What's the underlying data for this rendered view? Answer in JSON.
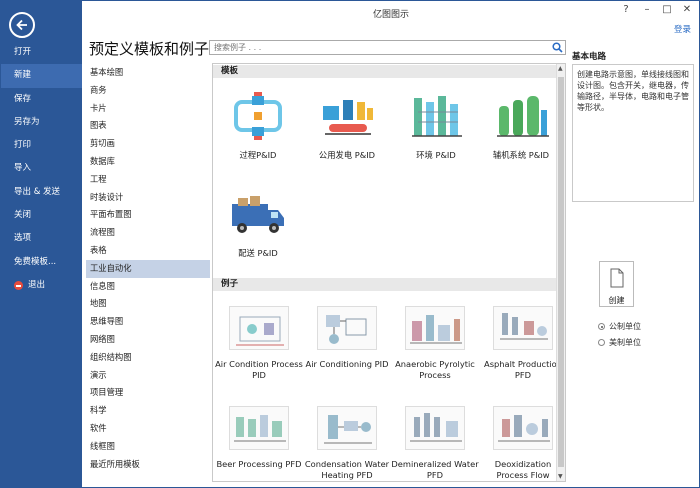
{
  "app": {
    "title": "亿图图示",
    "login": "登录"
  },
  "sidebar": {
    "items": [
      {
        "label": "打开"
      },
      {
        "label": "新建"
      },
      {
        "label": "保存"
      },
      {
        "label": "另存为"
      },
      {
        "label": "打印"
      },
      {
        "label": "导入"
      },
      {
        "label": "导出 & 发送"
      },
      {
        "label": "关闭"
      },
      {
        "label": "选项"
      },
      {
        "label": "免费模板..."
      },
      {
        "label": "退出"
      }
    ],
    "active": "新建"
  },
  "main": {
    "heading": "预定义模板和例子",
    "search_placeholder": "搜索例子 . . .",
    "categories": [
      "基本绘图",
      "商务",
      "卡片",
      "图表",
      "剪切画",
      "数据库",
      "工程",
      "时装设计",
      "平面布置图",
      "流程图",
      "表格",
      "工业自动化",
      "信息图",
      "地图",
      "思维导图",
      "网络图",
      "组织结构图",
      "演示",
      "项目管理",
      "科学",
      "软件",
      "线框图",
      "最近所用模板"
    ],
    "selected_category": "工业自动化",
    "templates_header": "模板",
    "templates": [
      {
        "label": "过程P&ID",
        "icon": "process-pid-icon"
      },
      {
        "label": "公用发电 P&ID",
        "icon": "utility-power-pid-icon"
      },
      {
        "label": "环境 P&ID",
        "icon": "environment-pid-icon"
      },
      {
        "label": "辅机系统 P&ID",
        "icon": "auxiliary-system-pid-icon"
      },
      {
        "label": "配送 P&ID",
        "icon": "delivery-truck-icon"
      }
    ],
    "examples_header": "例子",
    "examples": [
      {
        "label": "Air Condition Process PID"
      },
      {
        "label": "Air Conditioning PID"
      },
      {
        "label": "Anaerobic Pyrolytic Process"
      },
      {
        "label": "Asphalt Production PFD"
      },
      {
        "label": "Beer Processing PFD"
      },
      {
        "label": "Condensation Water Heating PFD"
      },
      {
        "label": "Demineralized Water PFD"
      },
      {
        "label": "Deoxidization Process Flow"
      }
    ]
  },
  "right": {
    "title": "基本电路",
    "description": "创建电路示意图，单线接线图和设计图。包含开关，继电器，传输路径，半导体，电路和电子管等形状。",
    "create_label": "创建",
    "units": [
      {
        "label": "公制单位",
        "selected": false
      },
      {
        "label": "美制单位",
        "selected": false
      }
    ]
  },
  "colors": {
    "sidebar": "#2b5797",
    "selected_category": "#c5d2e6",
    "accent": "#2b6cc4"
  }
}
